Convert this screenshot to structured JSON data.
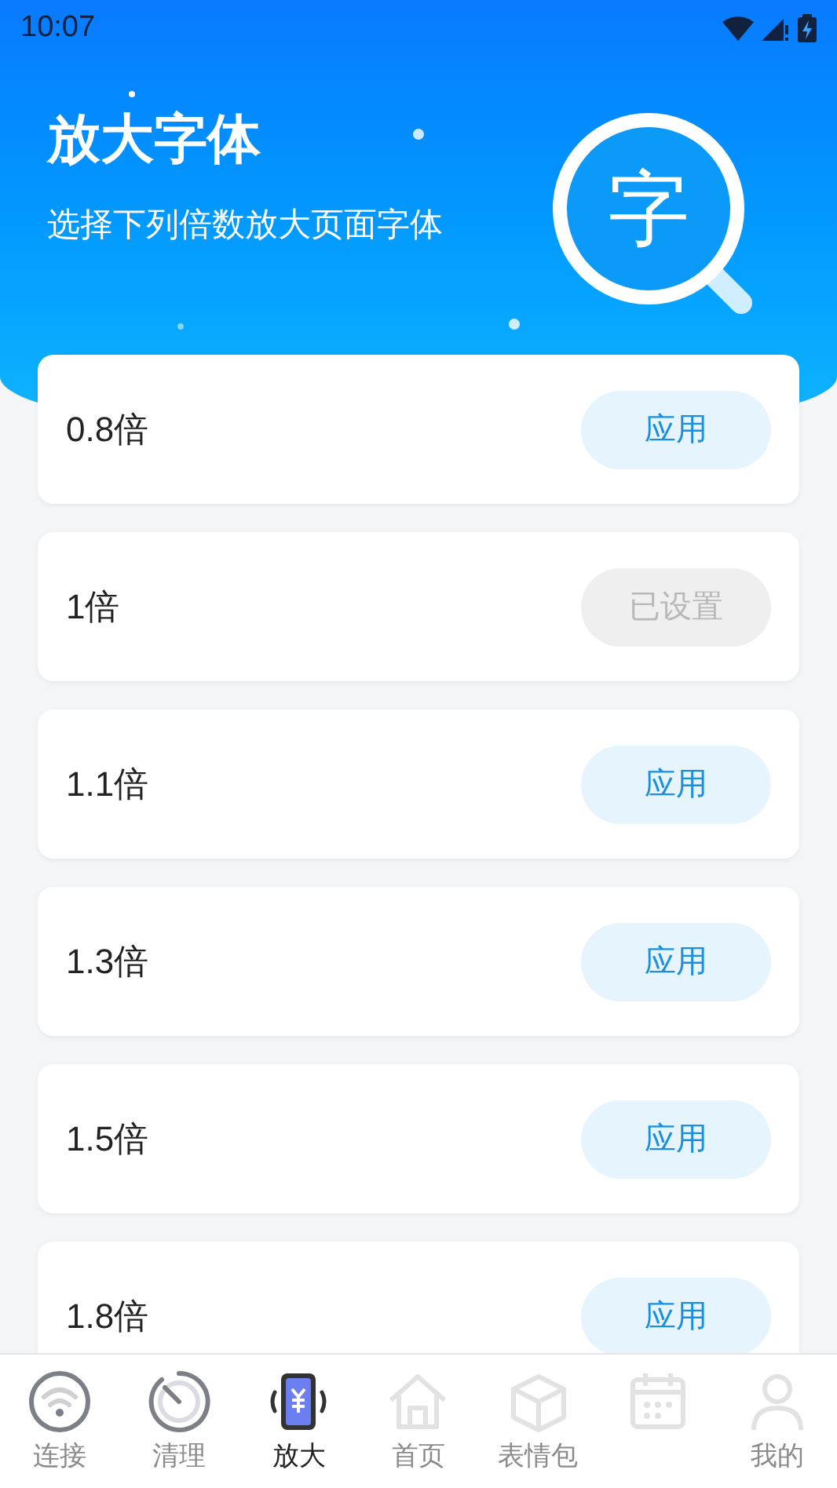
{
  "status_bar": {
    "time": "10:07"
  },
  "header": {
    "title": "放大字体",
    "subtitle": "选择下列倍数放大页面字体",
    "badge": "字"
  },
  "options": [
    {
      "label": "0.8倍",
      "button": "应用",
      "applied": false
    },
    {
      "label": "1倍",
      "button": "已设置",
      "applied": true
    },
    {
      "label": "1.1倍",
      "button": "应用",
      "applied": false
    },
    {
      "label": "1.3倍",
      "button": "应用",
      "applied": false
    },
    {
      "label": "1.5倍",
      "button": "应用",
      "applied": false
    },
    {
      "label": "1.8倍",
      "button": "应用",
      "applied": false
    }
  ],
  "nav": [
    {
      "kind": "wifi",
      "label": "连接",
      "selected": false
    },
    {
      "kind": "timer",
      "label": "清理",
      "selected": false
    },
    {
      "kind": "phone",
      "label": "放大",
      "selected": true
    },
    {
      "kind": "home",
      "label": "首页",
      "selected": false
    },
    {
      "kind": "box",
      "label": "表情包",
      "selected": false
    },
    {
      "kind": "calendar",
      "selected": false
    },
    {
      "kind": "person",
      "label": "我的",
      "selected": false
    }
  ]
}
